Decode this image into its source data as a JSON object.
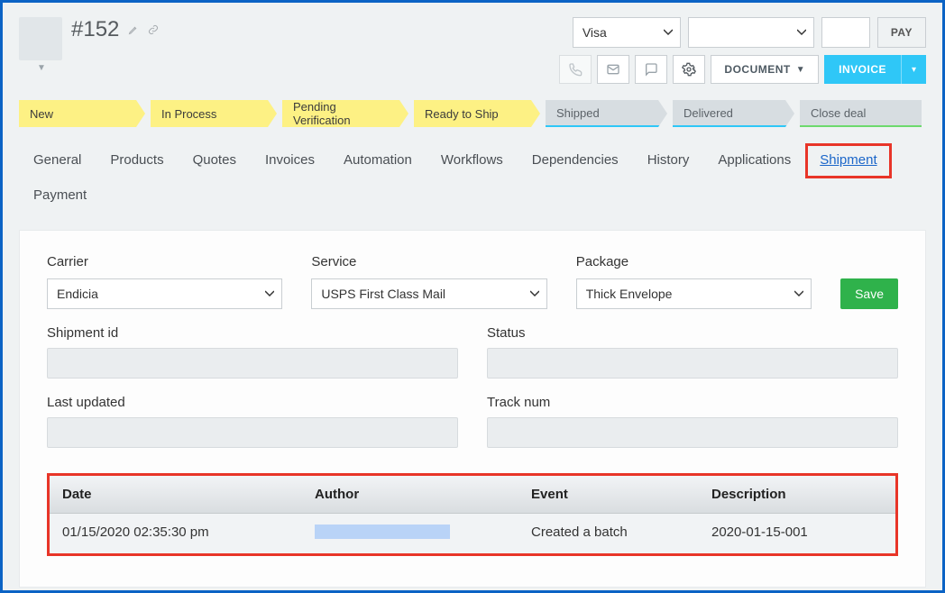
{
  "header": {
    "order_id": "#152"
  },
  "payment": {
    "card_option": "Visa",
    "blank_option": "",
    "amount": "",
    "pay_label": "PAY"
  },
  "actions": {
    "document_label": "DOCUMENT",
    "invoice_label": "INVOICE"
  },
  "pipeline": [
    "New",
    "In Process",
    "Pending Verification",
    "Ready to Ship",
    "Shipped",
    "Delivered",
    "Close deal"
  ],
  "tabs": [
    "General",
    "Products",
    "Quotes",
    "Invoices",
    "Automation",
    "Workflows",
    "Dependencies",
    "History",
    "Applications",
    "Shipment",
    "Payment"
  ],
  "shipment": {
    "carrier_label": "Carrier",
    "carrier_value": "Endicia",
    "service_label": "Service",
    "service_value": "USPS First Class Mail",
    "package_label": "Package",
    "package_value": "Thick Envelope",
    "save_label": "Save",
    "shipment_id_label": "Shipment id",
    "shipment_id_value": "",
    "status_label": "Status",
    "status_value": "",
    "last_updated_label": "Last updated",
    "last_updated_value": "",
    "track_num_label": "Track num",
    "track_num_value": ""
  },
  "log": {
    "headers": {
      "date": "Date",
      "author": "Author",
      "event": "Event",
      "desc": "Description"
    },
    "rows": [
      {
        "date": "01/15/2020 02:35:30 pm",
        "author": "",
        "event": "Created a batch",
        "desc": "2020-01-15-001"
      }
    ]
  }
}
